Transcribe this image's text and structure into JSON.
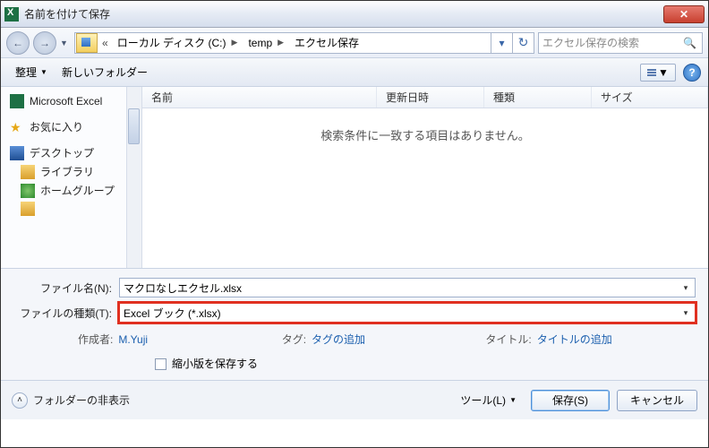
{
  "titlebar": {
    "title": "名前を付けて保存"
  },
  "breadcrumb": {
    "prefix": "«",
    "items": [
      {
        "label": "ローカル ディスク (C:)"
      },
      {
        "label": "temp"
      },
      {
        "label": "エクセル保存"
      }
    ]
  },
  "search": {
    "placeholder": "エクセル保存の検索"
  },
  "toolbar": {
    "organize": "整理",
    "new_folder": "新しいフォルダー"
  },
  "sidebar": {
    "excel": "Microsoft Excel",
    "favorites": "お気に入り",
    "desktop": "デスクトップ",
    "libraries": "ライブラリ",
    "homegroup": "ホームグループ",
    "user": ""
  },
  "columns": {
    "name": "名前",
    "date": "更新日時",
    "type": "種類",
    "size": "サイズ"
  },
  "list": {
    "empty": "検索条件に一致する項目はありません。"
  },
  "fields": {
    "filename_label": "ファイル名(N):",
    "filename_value": "マクロなしエクセル.xlsx",
    "filetype_label": "ファイルの種類(T):",
    "filetype_value": "Excel ブック (*.xlsx)"
  },
  "meta": {
    "author_label": "作成者:",
    "author_value": "M.Yuji",
    "tags_label": "タグ:",
    "tags_value": "タグの追加",
    "title_label": "タイトル:",
    "title_value": "タイトルの追加"
  },
  "thumb_checkbox": "縮小版を保存する",
  "footer": {
    "hide_folders": "フォルダーの非表示",
    "tools": "ツール(L)",
    "save": "保存(S)",
    "cancel": "キャンセル"
  }
}
